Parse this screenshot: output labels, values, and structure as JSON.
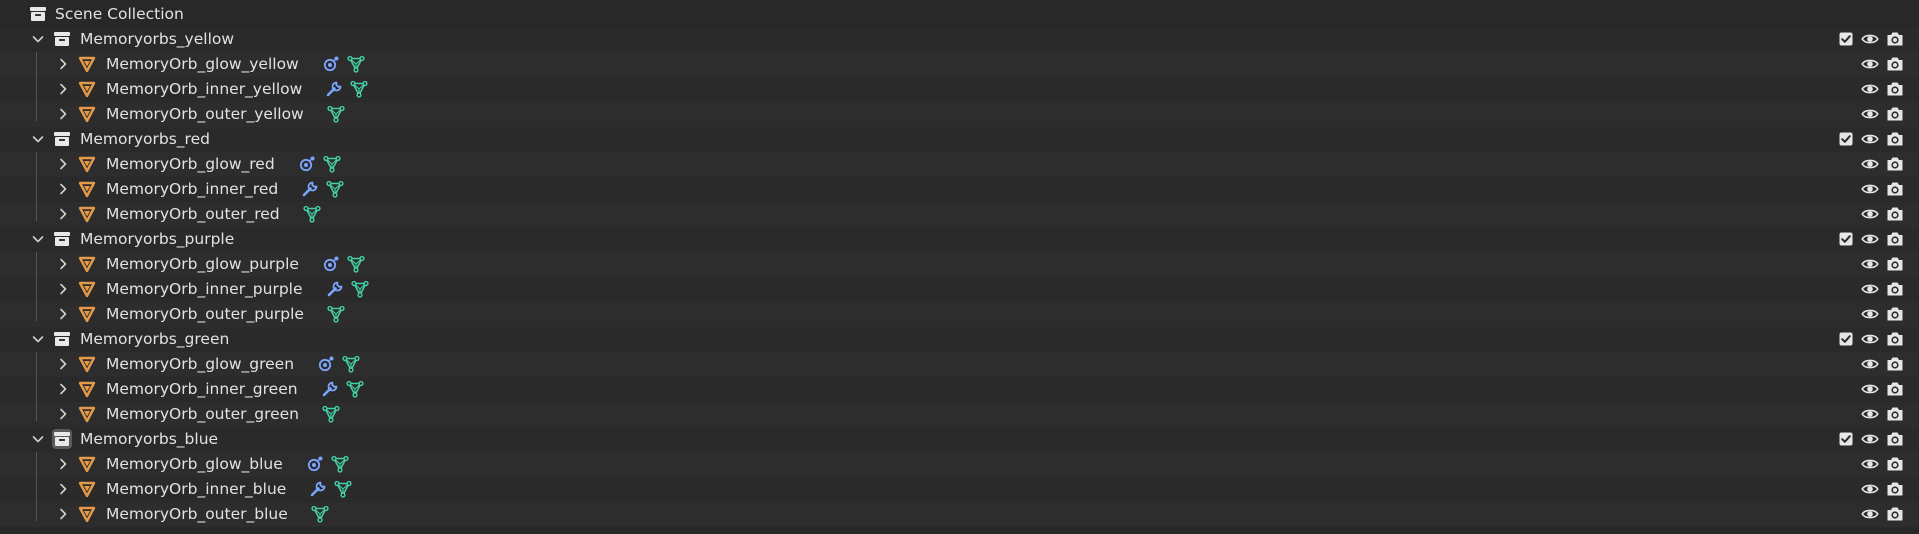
{
  "scene": {
    "label": "Scene Collection"
  },
  "colors": {
    "mesh_orange": "#e59a4a",
    "modifier_blue": "#7aa6ff",
    "data_green": "#44d1a6",
    "icon_light": "#e8e8e8"
  },
  "collections": [
    {
      "label": "Memoryorbs_yellow",
      "objects": [
        {
          "label": "MemoryOrb_glow_yellow",
          "modifier": "particle"
        },
        {
          "label": "MemoryOrb_inner_yellow",
          "modifier": "wrench"
        },
        {
          "label": "MemoryOrb_outer_yellow",
          "modifier": "none"
        }
      ]
    },
    {
      "label": "Memoryorbs_red",
      "objects": [
        {
          "label": "MemoryOrb_glow_red",
          "modifier": "particle"
        },
        {
          "label": "MemoryOrb_inner_red",
          "modifier": "wrench"
        },
        {
          "label": "MemoryOrb_outer_red",
          "modifier": "none"
        }
      ]
    },
    {
      "label": "Memoryorbs_purple",
      "objects": [
        {
          "label": "MemoryOrb_glow_purple",
          "modifier": "particle"
        },
        {
          "label": "MemoryOrb_inner_purple",
          "modifier": "wrench"
        },
        {
          "label": "MemoryOrb_outer_purple",
          "modifier": "none"
        }
      ]
    },
    {
      "label": "Memoryorbs_green",
      "objects": [
        {
          "label": "MemoryOrb_glow_green",
          "modifier": "particle"
        },
        {
          "label": "MemoryOrb_inner_green",
          "modifier": "wrench"
        },
        {
          "label": "MemoryOrb_outer_green",
          "modifier": "none"
        }
      ]
    },
    {
      "label": "Memoryorbs_blue",
      "objects": [
        {
          "label": "MemoryOrb_glow_blue",
          "modifier": "particle"
        },
        {
          "label": "MemoryOrb_inner_blue",
          "modifier": "wrench"
        },
        {
          "label": "MemoryOrb_outer_blue",
          "modifier": "none"
        }
      ]
    }
  ]
}
